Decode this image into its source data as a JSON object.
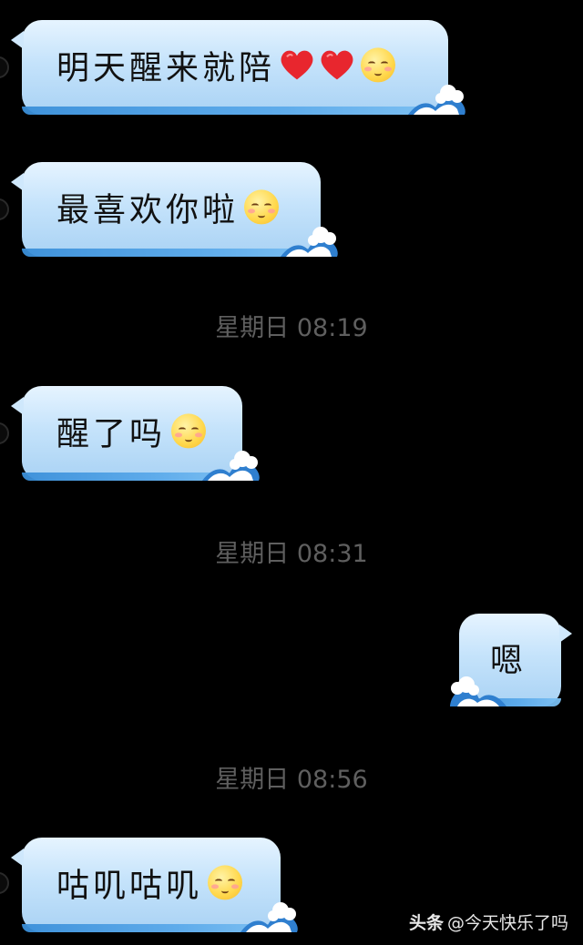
{
  "messages": [
    {
      "side": "left",
      "text": "明天醒来就陪",
      "decorations": [
        "heart-icon",
        "heart-icon",
        "blushing-smile-emoji"
      ]
    },
    {
      "side": "left",
      "text": "最喜欢你啦",
      "decorations": [
        "blushing-smile-emoji"
      ]
    },
    {
      "type": "timestamp",
      "text": "星期日 08:19"
    },
    {
      "side": "left",
      "text": "醒了吗",
      "decorations": [
        "blushing-smile-emoji"
      ]
    },
    {
      "type": "timestamp",
      "text": "星期日 08:31"
    },
    {
      "side": "right",
      "text": "嗯",
      "decorations": []
    },
    {
      "type": "timestamp",
      "text": "星期日 08:56"
    },
    {
      "side": "left",
      "text": "咕叽咕叽",
      "decorations": [
        "blushing-smile-emoji"
      ]
    }
  ],
  "watermark": {
    "brand": "头条",
    "handle": "@今天快乐了吗"
  },
  "colors": {
    "background": "#000000",
    "bubble_light": "#e6f4ff",
    "bubble_mid": "#c5e3fb",
    "bubble_rim": "#3a8fd9",
    "timestamp": "#5f5f5f",
    "heart": "#e8262e",
    "emoji_face": "#ffd74a"
  }
}
